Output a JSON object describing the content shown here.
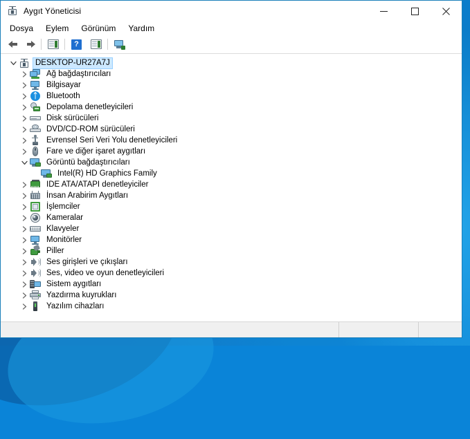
{
  "window": {
    "title": "Aygıt Yöneticisi",
    "title_icon": "device-manager-icon",
    "controls": {
      "minimize": "minimize-icon",
      "maximize": "maximize-icon",
      "close": "close-icon"
    }
  },
  "menubar": {
    "items": [
      {
        "label": "Dosya"
      },
      {
        "label": "Eylem"
      },
      {
        "label": "Görünüm"
      },
      {
        "label": "Yardım"
      }
    ]
  },
  "toolbar": {
    "buttons": [
      {
        "name": "back-button",
        "icon": "arrow-left-icon",
        "label": ""
      },
      {
        "name": "forward-button",
        "icon": "arrow-right-icon",
        "label": ""
      },
      {
        "name": "show-hide-console-tree-button",
        "icon": "console-tree-icon",
        "label": ""
      },
      {
        "name": "help-button",
        "icon": "help-question-icon",
        "label": ""
      },
      {
        "name": "properties-button",
        "icon": "properties-icon",
        "label": ""
      },
      {
        "name": "scan-for-hardware-changes-button",
        "icon": "scan-hardware-icon",
        "label": ""
      }
    ]
  },
  "tree": {
    "root": {
      "label": "DESKTOP-UR27A7J",
      "icon": "computer-root-icon",
      "expanded": true,
      "selected": true,
      "level": 0
    },
    "nodes": [
      {
        "label": "Ağ bağdaştırıcıları",
        "icon": "network-adapter-icon",
        "expanded": false,
        "level": 1
      },
      {
        "label": "Bilgisayar",
        "icon": "computer-icon",
        "expanded": false,
        "level": 1
      },
      {
        "label": "Bluetooth",
        "icon": "bluetooth-icon",
        "expanded": false,
        "level": 1
      },
      {
        "label": "Depolama denetleyicileri",
        "icon": "storage-controller-icon",
        "expanded": false,
        "level": 1
      },
      {
        "label": "Disk sürücüleri",
        "icon": "disk-drive-icon",
        "expanded": false,
        "level": 1
      },
      {
        "label": "DVD/CD-ROM sürücüleri",
        "icon": "dvd-drive-icon",
        "expanded": false,
        "level": 1
      },
      {
        "label": "Evrensel Seri Veri Yolu denetleyicileri",
        "icon": "usb-controller-icon",
        "expanded": false,
        "level": 1
      },
      {
        "label": "Fare ve diğer işaret aygıtları",
        "icon": "mouse-icon",
        "expanded": false,
        "level": 1
      },
      {
        "label": "Görüntü bağdaştırıcıları",
        "icon": "display-adapter-icon",
        "expanded": true,
        "level": 1
      },
      {
        "label": "Intel(R) HD Graphics Family",
        "icon": "display-adapter-icon",
        "expanded": null,
        "level": 2
      },
      {
        "label": "IDE ATA/ATAPI denetleyiciler",
        "icon": "ide-controller-icon",
        "expanded": false,
        "level": 1
      },
      {
        "label": "İnsan Arabirim Aygıtları",
        "icon": "human-interface-device-icon",
        "expanded": false,
        "level": 1
      },
      {
        "label": "İşlemciler",
        "icon": "processor-icon",
        "expanded": false,
        "level": 1
      },
      {
        "label": "Kameralar",
        "icon": "camera-icon",
        "expanded": false,
        "level": 1
      },
      {
        "label": "Klavyeler",
        "icon": "keyboard-icon",
        "expanded": false,
        "level": 1
      },
      {
        "label": "Monitörler",
        "icon": "monitor-icon",
        "expanded": false,
        "level": 1
      },
      {
        "label": "Piller",
        "icon": "battery-icon",
        "expanded": false,
        "level": 1
      },
      {
        "label": "Ses girişleri ve çıkışları",
        "icon": "audio-io-icon",
        "expanded": false,
        "level": 1
      },
      {
        "label": "Ses, video ve oyun denetleyicileri",
        "icon": "sound-video-game-controller-icon",
        "expanded": false,
        "level": 1
      },
      {
        "label": "Sistem aygıtları",
        "icon": "system-device-icon",
        "expanded": false,
        "level": 1
      },
      {
        "label": "Yazdırma kuyrukları",
        "icon": "print-queue-icon",
        "expanded": false,
        "level": 1
      },
      {
        "label": "Yazılım cihazları",
        "icon": "software-device-icon",
        "expanded": false,
        "level": 1
      }
    ]
  },
  "statusbar": {
    "pane_main": "",
    "pane_two": "",
    "pane_three": ""
  },
  "colors": {
    "titlebar_bg": "#ffffff",
    "window_border": "#1a7fba",
    "selection_bg": "#cce8ff",
    "desktop_blue": "#0f7fd0",
    "accent_green": "#3f9b3f",
    "icon_blue": "#6fb8e8"
  }
}
